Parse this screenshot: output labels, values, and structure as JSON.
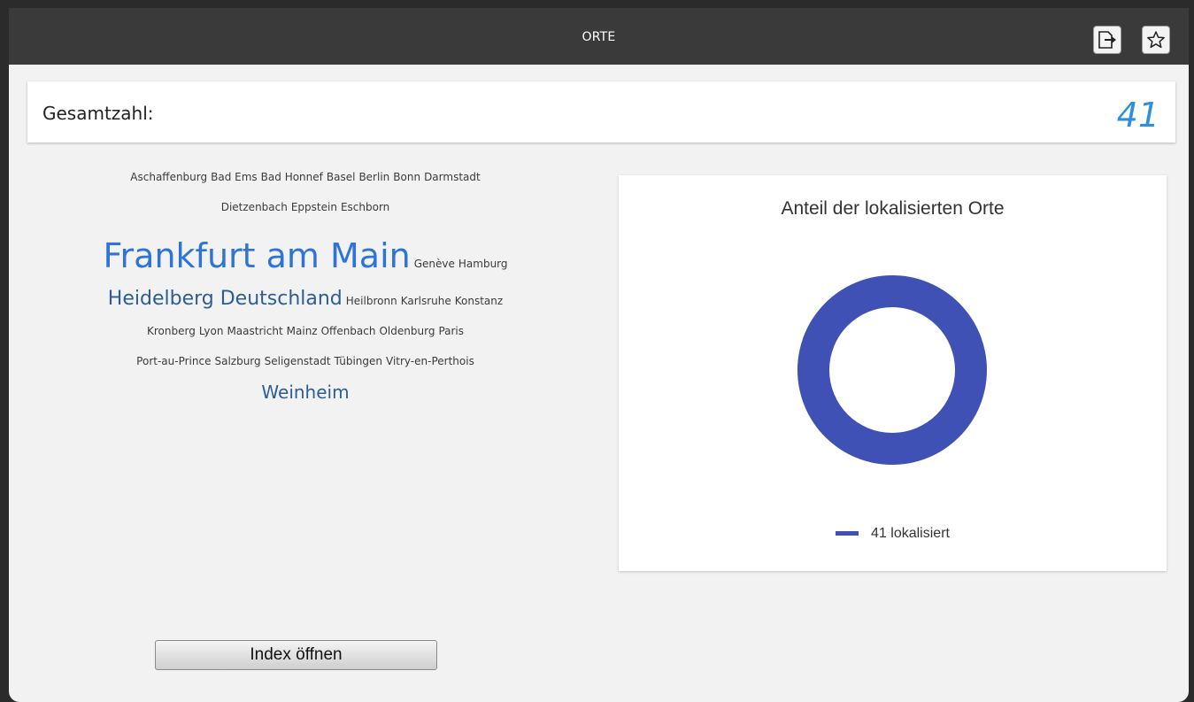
{
  "window": {
    "title": "ORTE"
  },
  "titlebar_buttons": [
    {
      "icon": "export-icon"
    },
    {
      "icon": "star-icon"
    }
  ],
  "summary": {
    "label": "Gesamtzahl:",
    "value": "41"
  },
  "cloud": {
    "lines": [
      [
        {
          "text": "Aschaffenburg",
          "size": "s"
        },
        {
          "text": "Bad Ems",
          "size": "s"
        },
        {
          "text": "Bad Honnef",
          "size": "s"
        },
        {
          "text": "Basel",
          "size": "s"
        },
        {
          "text": "Berlin",
          "size": "s"
        },
        {
          "text": "Bonn",
          "size": "s"
        },
        {
          "text": "Darmstadt",
          "size": "s"
        }
      ],
      [
        {
          "text": "Dietzenbach",
          "size": "s"
        },
        {
          "text": "Eppstein",
          "size": "s"
        },
        {
          "text": "Eschborn",
          "size": "s"
        }
      ],
      [
        {
          "text": "Frankfurt am Main",
          "size": "xl"
        },
        {
          "text": "Genève",
          "size": "s"
        },
        {
          "text": "Hamburg",
          "size": "s"
        }
      ],
      [
        {
          "text": "Heidelberg Deutschland",
          "size": "l"
        },
        {
          "text": "Heilbronn",
          "size": "s"
        },
        {
          "text": "Karlsruhe",
          "size": "s"
        },
        {
          "text": "Konstanz",
          "size": "s"
        }
      ],
      [
        {
          "text": "Kronberg",
          "size": "s"
        },
        {
          "text": "Lyon",
          "size": "s"
        },
        {
          "text": "Maastricht",
          "size": "s"
        },
        {
          "text": "Mainz",
          "size": "s"
        },
        {
          "text": "Offenbach",
          "size": "s"
        },
        {
          "text": "Oldenburg",
          "size": "s"
        },
        {
          "text": "Paris",
          "size": "s"
        }
      ],
      [
        {
          "text": "Port-au-Prince",
          "size": "s"
        },
        {
          "text": "Salzburg",
          "size": "s"
        },
        {
          "text": "Seligenstadt",
          "size": "s"
        },
        {
          "text": "Tübingen",
          "size": "s"
        },
        {
          "text": "Vitry-en-Perthois",
          "size": "s"
        }
      ],
      [
        {
          "text": "Weinheim",
          "size": "m"
        }
      ]
    ]
  },
  "chart_data": {
    "type": "pie",
    "title": "Anteil der lokalisierten Orte",
    "slices": [
      {
        "label": "41 lokalisiert",
        "value": 41,
        "color": "#3f51b5"
      }
    ],
    "donut": true
  },
  "index_button": {
    "label": "Index öffnen"
  },
  "colors": {
    "accent": "#2e8ee0",
    "chart": "#3f51b5",
    "titlebar": "#3a3a3a"
  }
}
